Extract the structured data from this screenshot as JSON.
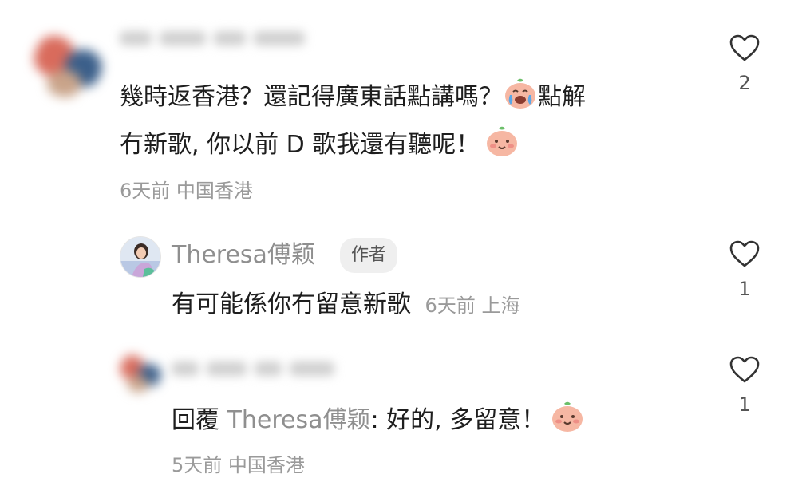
{
  "comments": [
    {
      "text_line1": "幾時返香港？還記得廣東話點講嗎？",
      "text_line1b": "點解",
      "text_line2": "冇新歌, 你以前 D 歌我還有聽呢！",
      "meta": "6天前 中国香港",
      "likes": "2",
      "emoji1": "crying-face-emoji",
      "emoji2": "smiling-face-emoji"
    },
    {
      "author": "Theresa傅颖",
      "badge": "作者",
      "text": "有可能係你冇留意新歌",
      "meta": "6天前 上海",
      "likes": "1"
    },
    {
      "reply_prefix": "回覆",
      "reply_to": "Theresa傅颖",
      "reply_text": ": 好的, 多留意！",
      "meta": "5天前 中国香港",
      "likes": "1",
      "emoji": "smiling-face-emoji"
    }
  ],
  "icons": {
    "like": "heart-outline-icon"
  },
  "colors": {
    "text": "#1e1e1e",
    "meta": "#9a9a9a",
    "badge_bg": "#efefef"
  }
}
